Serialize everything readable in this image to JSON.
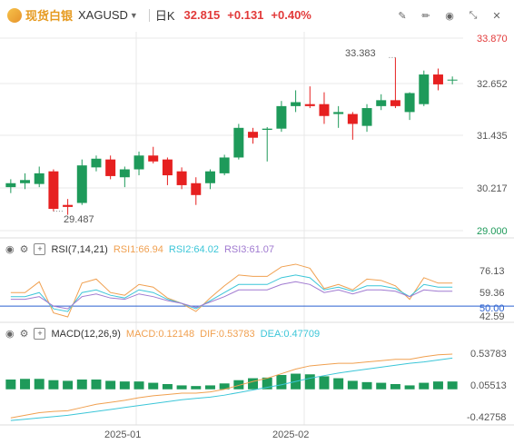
{
  "header": {
    "product": "现货白银",
    "symbol": "XAGUSD",
    "period": "日K",
    "price": "32.815",
    "change": "+0.131",
    "change_pct": "+0.40%"
  },
  "icons": [
    "pencil-line-icon",
    "pencil-icon",
    "eye-icon",
    "collapse-icon",
    "close-icon"
  ],
  "colors": {
    "up": "#e62020",
    "down": "#1e9a5a",
    "rsi1": "#f0a050",
    "rsi2": "#3cc6d8",
    "rsi3": "#a07ad0",
    "macd": "#f0a050",
    "dif": "#f0a050",
    "dea": "#3cc6d8",
    "gridline": "#e8e8e8"
  },
  "price_axis": {
    "labels": [
      "33.870",
      "32.652",
      "31.435",
      "30.217",
      "29.000"
    ],
    "high_label": "33.383",
    "low_label": "29.487"
  },
  "rsi": {
    "title": "RSI(7,14,21)",
    "rsi1": "RSI1:66.94",
    "rsi2": "RSI2:64.02",
    "rsi3": "RSI3:61.07",
    "axis": [
      "76.13",
      "59.36",
      "50.00",
      "42.59"
    ]
  },
  "macd": {
    "title": "MACD(12,26,9)",
    "macd": "MACD:0.12148",
    "dif": "DIF:0.53783",
    "dea": "DEA:0.47709",
    "axis": [
      "0.53783",
      "0.05513",
      "-0.42758"
    ]
  },
  "xaxis": [
    "2025-01",
    "2025-02"
  ],
  "chart_data": [
    {
      "type": "candlestick",
      "ylim": [
        29.0,
        33.87
      ],
      "candles": [
        {
          "o": 30.1,
          "c": 30.2,
          "h": 30.3,
          "l": 29.95
        },
        {
          "o": 30.2,
          "c": 30.28,
          "h": 30.45,
          "l": 30.05
        },
        {
          "o": 30.18,
          "c": 30.45,
          "h": 30.62,
          "l": 30.1
        },
        {
          "o": 30.5,
          "c": 29.55,
          "h": 30.55,
          "l": 29.49
        },
        {
          "o": 29.65,
          "c": 29.6,
          "h": 29.8,
          "l": 29.4
        },
        {
          "o": 29.7,
          "c": 30.65,
          "h": 30.8,
          "l": 29.65
        },
        {
          "o": 30.6,
          "c": 30.82,
          "h": 30.9,
          "l": 30.5
        },
        {
          "o": 30.8,
          "c": 30.38,
          "h": 30.9,
          "l": 30.3
        },
        {
          "o": 30.35,
          "c": 30.55,
          "h": 30.62,
          "l": 30.1
        },
        {
          "o": 30.55,
          "c": 30.9,
          "h": 31.0,
          "l": 30.4
        },
        {
          "o": 30.9,
          "c": 30.75,
          "h": 31.12,
          "l": 30.7
        },
        {
          "o": 30.8,
          "c": 30.4,
          "h": 30.85,
          "l": 30.15
        },
        {
          "o": 30.5,
          "c": 30.15,
          "h": 30.6,
          "l": 30.05
        },
        {
          "o": 30.2,
          "c": 29.9,
          "h": 30.35,
          "l": 29.65
        },
        {
          "o": 30.2,
          "c": 30.5,
          "h": 30.55,
          "l": 30.05
        },
        {
          "o": 30.45,
          "c": 30.85,
          "h": 30.92,
          "l": 30.4
        },
        {
          "o": 30.85,
          "c": 31.6,
          "h": 31.7,
          "l": 30.8
        },
        {
          "o": 31.5,
          "c": 31.35,
          "h": 31.6,
          "l": 31.2
        },
        {
          "o": 31.55,
          "c": 31.58,
          "h": 31.62,
          "l": 30.75
        },
        {
          "o": 31.58,
          "c": 32.15,
          "h": 32.28,
          "l": 31.5
        },
        {
          "o": 32.15,
          "c": 32.25,
          "h": 32.55,
          "l": 32.0
        },
        {
          "o": 32.2,
          "c": 32.15,
          "h": 32.65,
          "l": 32.1
        },
        {
          "o": 32.2,
          "c": 31.9,
          "h": 32.5,
          "l": 31.7
        },
        {
          "o": 31.95,
          "c": 32.0,
          "h": 32.15,
          "l": 31.6
        },
        {
          "o": 31.95,
          "c": 31.7,
          "h": 32.0,
          "l": 31.3
        },
        {
          "o": 31.65,
          "c": 32.1,
          "h": 32.2,
          "l": 31.5
        },
        {
          "o": 32.15,
          "c": 32.3,
          "h": 32.45,
          "l": 32.05
        },
        {
          "o": 32.3,
          "c": 32.15,
          "h": 33.38,
          "l": 32.1
        },
        {
          "o": 32.0,
          "c": 32.48,
          "h": 32.5,
          "l": 31.8
        },
        {
          "o": 32.2,
          "c": 32.95,
          "h": 33.05,
          "l": 32.15
        },
        {
          "o": 32.95,
          "c": 32.7,
          "h": 33.1,
          "l": 32.55
        },
        {
          "o": 32.8,
          "c": 32.82,
          "h": 32.9,
          "l": 32.7
        }
      ]
    },
    {
      "type": "line",
      "ylim": [
        40,
        85
      ],
      "series": [
        {
          "name": "RSI1",
          "values": [
            60,
            60,
            68,
            45,
            42,
            67,
            70,
            60,
            58,
            66,
            64,
            56,
            52,
            46,
            56,
            65,
            73,
            72,
            72,
            79,
            81,
            78,
            63,
            66,
            62,
            70,
            69,
            65,
            55,
            71,
            67,
            67
          ]
        },
        {
          "name": "RSI2",
          "values": [
            57,
            57,
            60,
            48,
            46,
            60,
            62,
            58,
            56,
            62,
            60,
            55,
            52,
            48,
            54,
            60,
            66,
            66,
            66,
            71,
            73,
            71,
            62,
            64,
            61,
            65,
            65,
            63,
            57,
            66,
            64,
            64
          ]
        },
        {
          "name": "RSI3",
          "values": [
            55,
            55,
            57,
            50,
            48,
            57,
            59,
            56,
            55,
            59,
            57,
            54,
            52,
            49,
            53,
            57,
            62,
            62,
            62,
            66,
            68,
            66,
            60,
            62,
            59,
            62,
            62,
            61,
            57,
            62,
            61,
            61
          ]
        }
      ]
    },
    {
      "type": "bar",
      "ylim": [
        -0.52,
        0.75
      ],
      "series": [
        {
          "name": "MACD",
          "values": [
            0.15,
            0.16,
            0.16,
            0.14,
            0.13,
            0.15,
            0.15,
            0.13,
            0.12,
            0.12,
            0.1,
            0.08,
            0.06,
            0.05,
            0.06,
            0.09,
            0.14,
            0.17,
            0.18,
            0.22,
            0.24,
            0.23,
            0.2,
            0.17,
            0.13,
            0.11,
            0.1,
            0.08,
            0.06,
            0.1,
            0.12,
            0.12
          ]
        },
        {
          "name": "DIF",
          "values": [
            -0.44,
            -0.4,
            -0.36,
            -0.34,
            -0.33,
            -0.28,
            -0.23,
            -0.2,
            -0.17,
            -0.13,
            -0.1,
            -0.08,
            -0.06,
            -0.06,
            -0.04,
            0.0,
            0.06,
            0.12,
            0.17,
            0.24,
            0.31,
            0.36,
            0.38,
            0.4,
            0.4,
            0.42,
            0.44,
            0.46,
            0.46,
            0.5,
            0.53,
            0.54
          ]
        },
        {
          "name": "DEA",
          "values": [
            -0.48,
            -0.46,
            -0.44,
            -0.42,
            -0.4,
            -0.37,
            -0.34,
            -0.31,
            -0.28,
            -0.25,
            -0.22,
            -0.19,
            -0.16,
            -0.14,
            -0.12,
            -0.09,
            -0.05,
            -0.01,
            0.03,
            0.07,
            0.12,
            0.17,
            0.21,
            0.25,
            0.28,
            0.31,
            0.34,
            0.37,
            0.4,
            0.42,
            0.45,
            0.48
          ]
        }
      ]
    }
  ]
}
